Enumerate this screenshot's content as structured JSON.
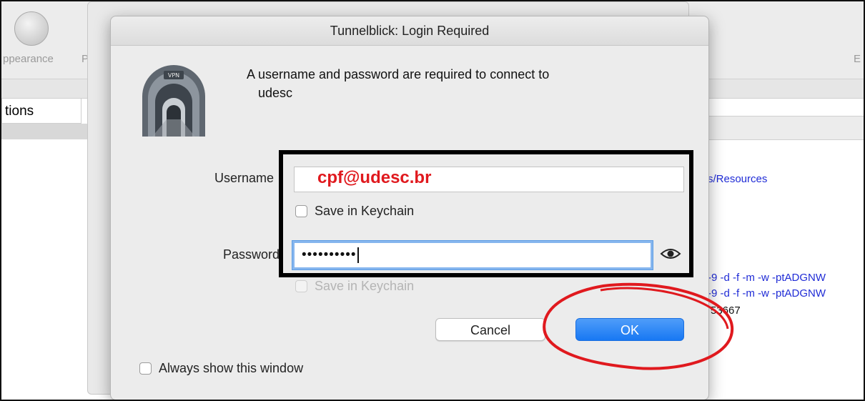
{
  "background_window": {
    "toolbar_labels": [
      "ppearance",
      "P",
      "E"
    ],
    "sidebar_tab": "tions",
    "right_column": {
      "resources_link": "s/Resources",
      "cmd_line_1": "-9 -d -f -m -w -ptADGNW",
      "cmd_line_2": "-9 -d -f -m -w -ptADGNW",
      "number": "53667"
    }
  },
  "dialog": {
    "title": "Tunnelblick: Login Required",
    "prompt_line1": "A username and password are required to connect to",
    "prompt_line2": "udesc",
    "username_label": "Username",
    "username_value": "cpf@udesc.br",
    "username_save_label": "Save in Keychain",
    "password_label": "Password",
    "password_value": "••••••••••",
    "password_save_label": "Save in Keychain",
    "cancel_label": "Cancel",
    "ok_label": "OK",
    "always_show_label": "Always show this window"
  },
  "colors": {
    "annotation_red": "#e0191e",
    "ok_blue": "#1878f3",
    "link_blue": "#1f2bd6"
  },
  "icons": [
    "vpn-tunnel-icon",
    "eye-icon",
    "appearance-icon"
  ]
}
